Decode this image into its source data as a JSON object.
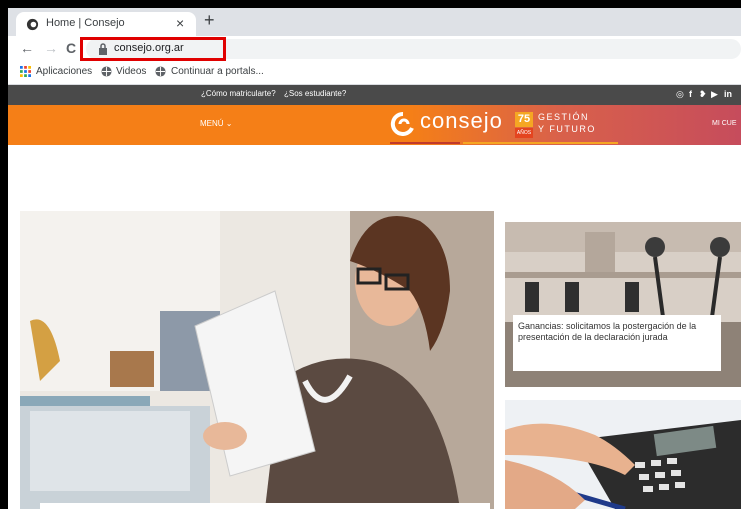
{
  "browser": {
    "tab_title": "Home | Consejo",
    "tab_close": "×",
    "new_tab": "+",
    "url": "consejo.org.ar",
    "nav": {
      "back": "←",
      "forward": "→",
      "reload": "C"
    }
  },
  "bookmarks": [
    {
      "label": "Aplicaciones",
      "icon": "apps-grid-icon"
    },
    {
      "label": "Videos",
      "icon": "globe-icon"
    },
    {
      "label": "Continuar a portals...",
      "icon": "globe-icon"
    }
  ],
  "site": {
    "topbar_links": [
      "¿Cómo matricularte?",
      "¿Sos estudiante?"
    ],
    "social_icons": [
      "instagram-icon",
      "facebook-icon",
      "twitter-icon",
      "youtube-icon",
      "linkedin-icon"
    ],
    "menu_label": "MENÚ  ⌄",
    "logo_text": "consejo",
    "badge_number": "75",
    "badge_sub": "AÑOS",
    "slogan_line1": "GESTIÓN",
    "slogan_line2": "Y FUTURO",
    "account_label": "MI CUE",
    "colors": {
      "orange": "#f57f17",
      "bar": "#4a4a4a",
      "accent": "#e00000"
    }
  },
  "news": {
    "card1_caption": "Ganancias: solicitamos la postergación de la presentación de la declaración jurada"
  }
}
